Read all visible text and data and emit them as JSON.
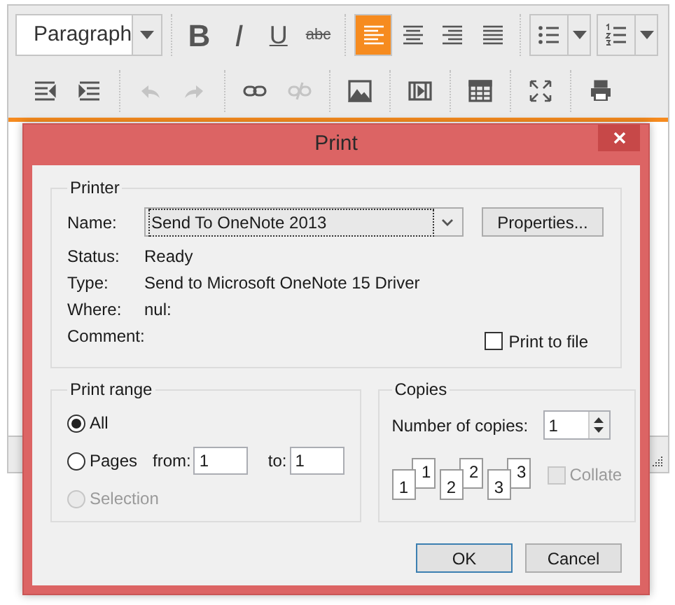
{
  "toolbar": {
    "format_select": {
      "value": "Paragraph"
    },
    "text_styles": [
      {
        "kind": "bold",
        "label": "B"
      },
      {
        "kind": "italic",
        "label": "I"
      },
      {
        "kind": "underline",
        "label": "U"
      },
      {
        "kind": "strike",
        "label": "abc"
      }
    ],
    "align_buttons": [
      {
        "kind": "left",
        "selected": true
      },
      {
        "kind": "center",
        "selected": false
      },
      {
        "kind": "right",
        "selected": false
      },
      {
        "kind": "justify",
        "selected": false
      }
    ],
    "list_buttons": [
      {
        "kind": "bullet"
      },
      {
        "kind": "numbered"
      }
    ],
    "groups": [
      [
        {
          "kind": "outdent",
          "disabled": false
        },
        {
          "kind": "indent",
          "disabled": false
        }
      ],
      [
        {
          "kind": "undo",
          "disabled": true
        },
        {
          "kind": "redo",
          "disabled": true
        }
      ],
      [
        {
          "kind": "link",
          "disabled": false
        },
        {
          "kind": "unlink",
          "disabled": true
        }
      ],
      [
        {
          "kind": "image",
          "disabled": false
        }
      ],
      [
        {
          "kind": "video",
          "disabled": false
        }
      ],
      [
        {
          "kind": "table",
          "disabled": false
        }
      ],
      [
        {
          "kind": "fullscreen",
          "disabled": false
        }
      ],
      [
        {
          "kind": "print",
          "disabled": false
        }
      ]
    ]
  },
  "dialog": {
    "title": "Print",
    "printer": {
      "legend": "Printer",
      "name_label": "Name:",
      "name_value": "Send To OneNote 2013",
      "properties_button": "Properties...",
      "info": [
        {
          "label": "Status:",
          "value": "Ready"
        },
        {
          "label": "Type:",
          "value": "Send to Microsoft OneNote 15 Driver"
        },
        {
          "label": "Where:",
          "value": "nul:"
        },
        {
          "label": "Comment:"
        }
      ],
      "print_to_file": {
        "label": "Print to file",
        "checked": false
      }
    },
    "print_range": {
      "legend": "Print range",
      "options": [
        {
          "kind": "all",
          "label": "All",
          "selected": true,
          "disabled": false
        },
        {
          "kind": "pages",
          "label": "Pages",
          "selected": false,
          "disabled": false
        },
        {
          "kind": "selection",
          "label": "Selection",
          "selected": false,
          "disabled": true
        }
      ],
      "from_label": "from:",
      "from_value": "1",
      "to_label": "to:",
      "to_value": "1"
    },
    "copies": {
      "legend": "Copies",
      "number_label": "Number of copies:",
      "number_value": "1",
      "collate_icons": [
        {
          "back": "1",
          "front": "1"
        },
        {
          "back": "2",
          "front": "2"
        },
        {
          "back": "3",
          "front": "3"
        }
      ],
      "collate": {
        "label": "Collate",
        "checked": false,
        "disabled": true
      }
    },
    "buttons": [
      {
        "label": "OK",
        "default": true
      },
      {
        "label": "Cancel",
        "default": false
      }
    ]
  }
}
